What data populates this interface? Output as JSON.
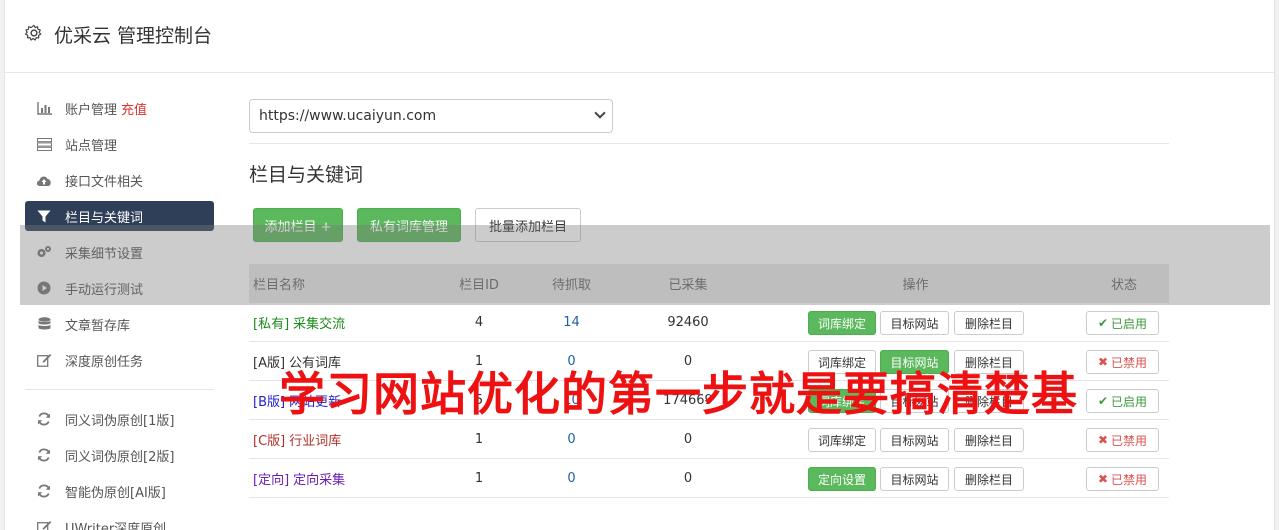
{
  "header": {
    "title": "优采云 管理控制台",
    "icon": "gear-icon"
  },
  "sidebar": {
    "items": [
      {
        "label": "账户管理",
        "extra": "充值",
        "icon": "bar-chart-icon"
      },
      {
        "label": "站点管理",
        "icon": "server-icon"
      },
      {
        "label": "接口文件相关",
        "icon": "cloud-upload-icon"
      },
      {
        "label": "栏目与关键词",
        "icon": "filter-icon",
        "active": true
      },
      {
        "label": "采集细节设置",
        "icon": "cogs-icon"
      },
      {
        "label": "手动运行测试",
        "icon": "play-circle-icon"
      },
      {
        "label": "文章暂存库",
        "icon": "database-icon"
      },
      {
        "label": "深度原创任务",
        "icon": "edit-icon"
      }
    ],
    "items2": [
      {
        "label": "同义词伪原创[1版]",
        "icon": "refresh-icon"
      },
      {
        "label": "同义词伪原创[2版]",
        "icon": "refresh-icon"
      },
      {
        "label": "智能伪原创[AI版]",
        "icon": "refresh-icon"
      },
      {
        "label": "UWriter深度原创",
        "icon": "edit-icon"
      }
    ]
  },
  "main": {
    "site_select": "https://www.ucaiyun.com",
    "section_title": "栏目与关键词",
    "buttons": {
      "add_column": "添加栏目 +",
      "private_lexicon": "私有词库管理",
      "batch_add": "批量添加栏目"
    },
    "table": {
      "headers": {
        "name": "栏目名称",
        "id": "栏目ID",
        "wait": "待抓取",
        "done": "已采集",
        "ops": "操作",
        "state": "状态"
      },
      "rows": [
        {
          "tag": "[私有]",
          "name": "采集交流",
          "id": "4",
          "wait": "14",
          "done": "92460",
          "op1": "词库绑定",
          "op1_green": true,
          "op2": "目标网站",
          "op2_green": false,
          "op3": "删除栏目",
          "state": "已启用",
          "enabled": true,
          "color": "green"
        },
        {
          "tag": "[A版]",
          "name": "公有词库",
          "id": "1",
          "wait": "0",
          "done": "0",
          "op1": "词库绑定",
          "op1_green": false,
          "op2": "目标网站",
          "op2_green": true,
          "op3": "删除栏目",
          "state": "已禁用",
          "enabled": false,
          "color": "dark"
        },
        {
          "tag": "[B版]",
          "name": "网站更新",
          "id": "5",
          "wait": "10",
          "done": "174669",
          "op1": "词库绑定",
          "op1_green": true,
          "op2": "目标网站",
          "op2_green": false,
          "op3": "删除栏目",
          "state": "已启用",
          "enabled": true,
          "color": "blue"
        },
        {
          "tag": "[C版]",
          "name": "行业词库",
          "id": "1",
          "wait": "0",
          "done": "0",
          "op1": "词库绑定",
          "op1_green": false,
          "op2": "目标网站",
          "op2_green": false,
          "op3": "删除栏目",
          "state": "已禁用",
          "enabled": false,
          "color": "red"
        },
        {
          "tag": "[定向]",
          "name": "定向采集",
          "id": "1",
          "wait": "0",
          "done": "0",
          "op1": "定向设置",
          "op1_green": true,
          "op2": "目标网站",
          "op2_green": false,
          "op3": "删除栏目",
          "state": "已禁用",
          "enabled": false,
          "color": "purple"
        }
      ]
    }
  },
  "watermark": "学习网站优化的第一步就是要搞清楚基",
  "colors": {
    "active_nav": "#2f3f58",
    "green": "#5cb85c",
    "red_text": "#ee1111"
  }
}
